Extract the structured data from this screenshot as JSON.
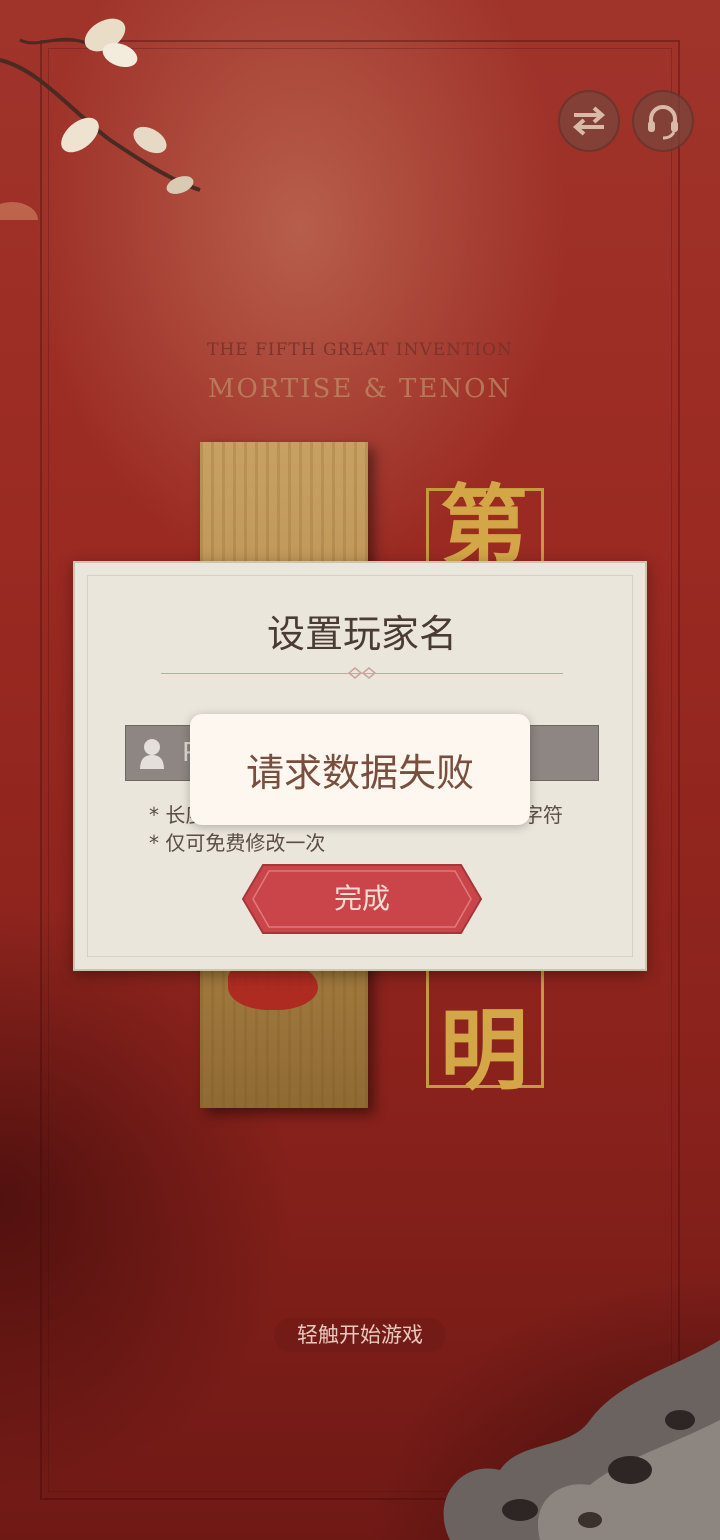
{
  "header": {
    "switch_icon": "swap-arrows-icon",
    "service_icon": "headset-icon"
  },
  "logo": {
    "subtitle": "THE FIFTH GREAT INVENTION",
    "title": "MORTISE & TENON",
    "char_top": "第",
    "char_bottom": "明"
  },
  "dialog": {
    "title": "设置玩家名",
    "input_value": "P",
    "input_icon": "user-icon",
    "hint_length_prefix": "* 长度",
    "hint_length_suffix": "字符",
    "hint_once": "* 仅可免费修改一次",
    "done_label": "完成"
  },
  "toast": {
    "message": "请求数据失败"
  },
  "footer": {
    "start_hint": "轻触开始游戏"
  },
  "colors": {
    "background": "#9a2a22",
    "dialog": "#ebe6dc",
    "button": "#c9454a",
    "gold": "#d3a647"
  }
}
